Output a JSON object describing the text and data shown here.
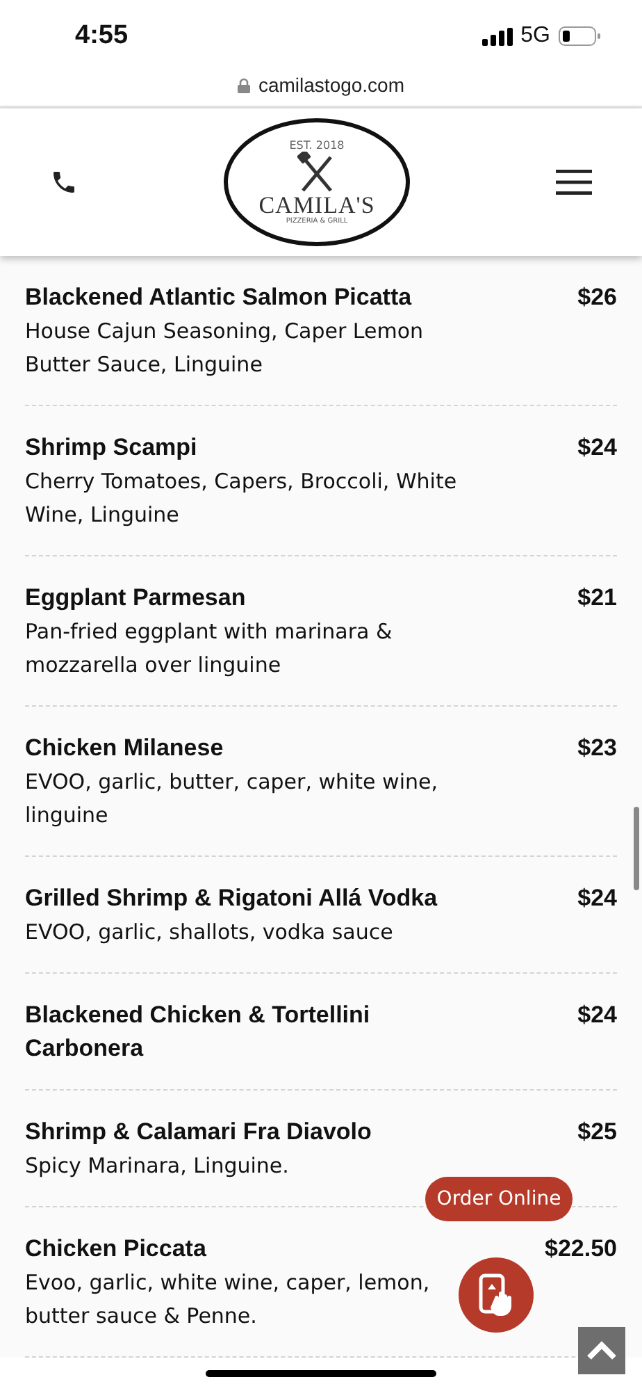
{
  "status_bar": {
    "time": "4:55",
    "network": "5G"
  },
  "browser": {
    "url": "camilastogo.com"
  },
  "header": {
    "logo": {
      "established": "EST. 2018",
      "name": "CAMILA'S",
      "tagline": "PIZZERIA & GRILL"
    }
  },
  "menu_items": [
    {
      "name": "Blackened Atlantic Salmon Picatta",
      "description": "House Cajun Seasoning, Caper Lemon Butter Sauce, Linguine",
      "price": "$26"
    },
    {
      "name": "Shrimp Scampi",
      "description": "Cherry Tomatoes, Capers, Broccoli, White Wine, Linguine",
      "price": "$24"
    },
    {
      "name": "Eggplant Parmesan",
      "description": "Pan-fried eggplant with marinara & mozzarella over linguine",
      "price": "$21"
    },
    {
      "name": "Chicken Milanese",
      "description": "EVOO, garlic, butter, caper, white wine, linguine",
      "price": "$23"
    },
    {
      "name": "Grilled Shrimp & Rigatoni Allá Vodka",
      "description": "EVOO, garlic, shallots, vodka sauce",
      "price": "$24"
    },
    {
      "name": "Blackened Chicken & Tortellini Carbonera",
      "price": "$24"
    },
    {
      "name": "Shrimp & Calamari Fra Diavolo",
      "description": "Spicy Marinara, Linguine.",
      "price": "$25"
    },
    {
      "name": "Chicken Piccata",
      "description": "Evoo, garlic, white wine, caper, lemon, butter sauce & Penne.",
      "price": "$22.50"
    }
  ],
  "order_button": {
    "label": "Order Online"
  }
}
